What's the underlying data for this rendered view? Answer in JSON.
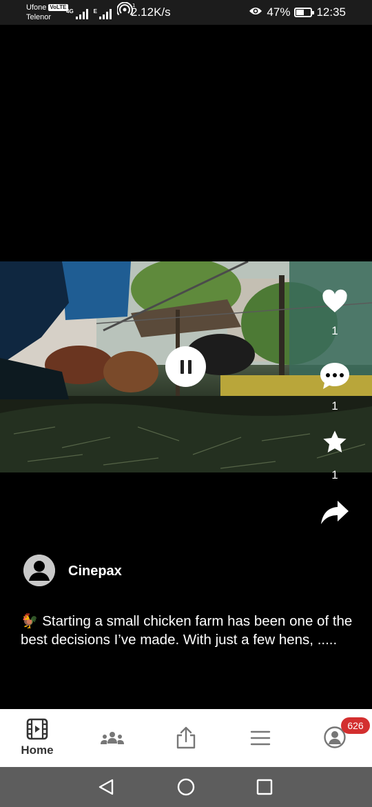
{
  "status_bar": {
    "carrier_1": "Ufone",
    "volte": "VoLTE",
    "carrier_2": "Telenor",
    "network_4g": "4G",
    "network_e": "E",
    "net_speed": "2.12K/s",
    "battery": "47%",
    "battery_level": 0.47,
    "time": "12:35"
  },
  "actions": {
    "like_count": "1",
    "comment_count": "1",
    "star_count": "1"
  },
  "post": {
    "author": "Cinepax",
    "caption": "🐓 Starting a small chicken farm has been one of the best decisions I’ve made. With just a few hens, ....."
  },
  "bottom_nav": {
    "home_label": "Home",
    "notification_count": "626"
  },
  "icons": {
    "like": "heart-icon",
    "comment": "comment-icon",
    "star": "star-icon",
    "share": "share-icon",
    "home": "film-icon",
    "community": "group-icon",
    "upload": "upload-icon",
    "menu": "menu-icon",
    "profile": "user-icon"
  }
}
